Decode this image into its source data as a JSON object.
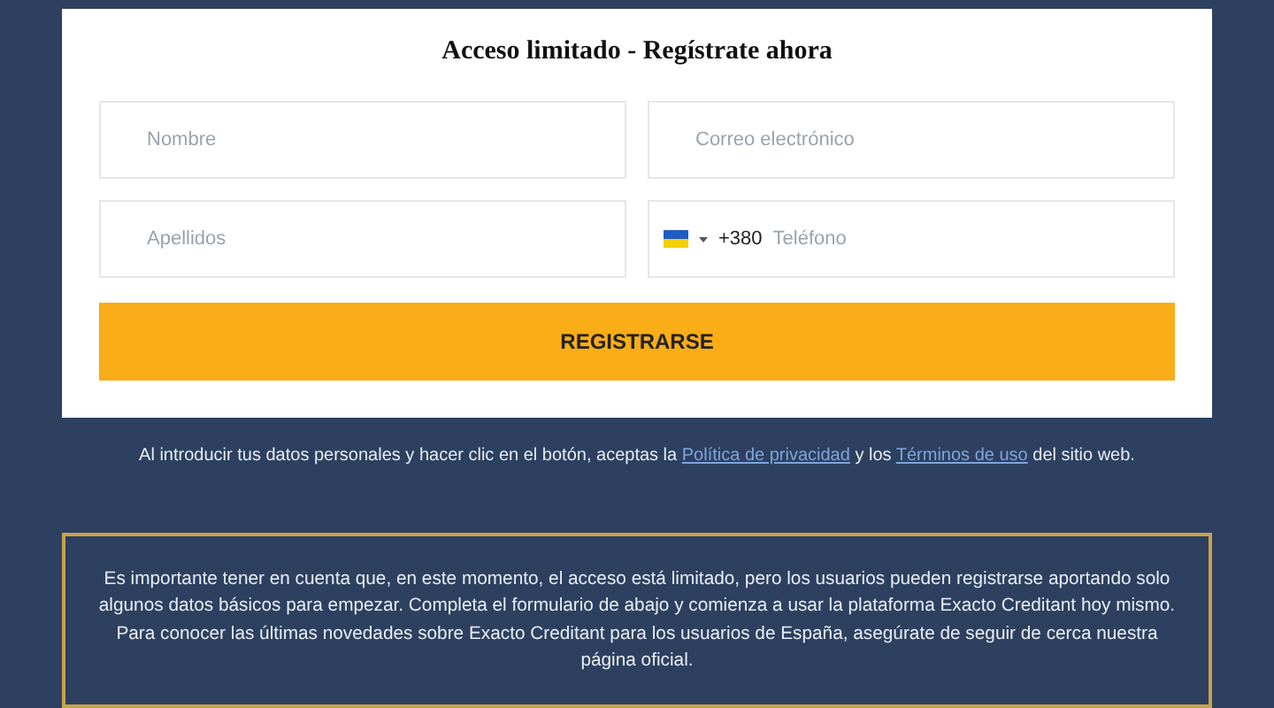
{
  "form": {
    "title": "Acceso limitado - Regístrate ahora",
    "fields": [
      {
        "kind": "text",
        "placeholder": "Nombre"
      },
      {
        "kind": "text",
        "placeholder": "Correo electrónico"
      },
      {
        "kind": "text",
        "placeholder": "Apellidos"
      },
      {
        "kind": "phone",
        "dial_code": "+380",
        "placeholder": "Teléfono"
      }
    ],
    "submit": "REGISTRARSE"
  },
  "consent": {
    "before": "Al introducir tus datos personales y hacer clic en el botón, aceptas la ",
    "privacy_link": "Política de privacidad",
    "middle": " y los ",
    "terms_link": "Términos de uso",
    "after": " del sitio web."
  },
  "notice": "Es importante tener en cuenta que, en este momento, el acceso está limitado, pero los usuarios pueden registrarse aportando solo algunos datos básicos para empezar. Completa el formulario de abajo y comienza a usar la plataforma Exacto Creditant hoy mismo. Para conocer las últimas novedades sobre Exacto Creditant para los usuarios de España, asegúrate de seguir de cerca nuestra página oficial."
}
